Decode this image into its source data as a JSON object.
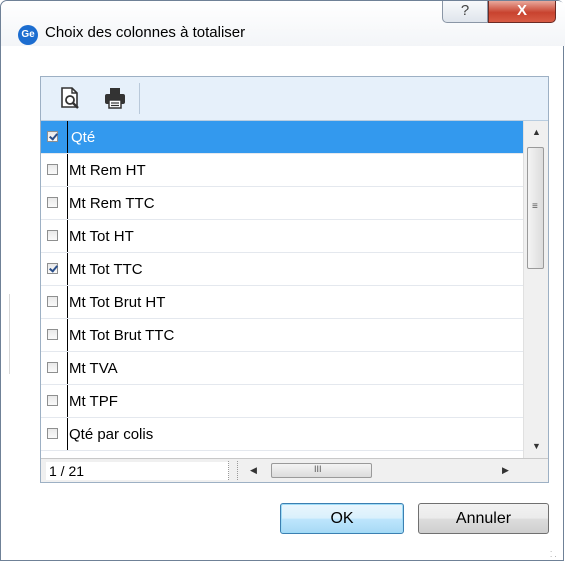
{
  "window": {
    "app_icon_text": "Ge",
    "title": "Choix des colonnes à totaliser",
    "help_symbol": "?",
    "close_symbol": "X"
  },
  "toolbar": {
    "buttons": [
      {
        "icon": "print-preview-icon"
      },
      {
        "icon": "printer-icon"
      }
    ]
  },
  "columns_list": {
    "rows": [
      {
        "label": "Qté",
        "checked": true,
        "selected": true
      },
      {
        "label": "Mt Rem HT",
        "checked": false,
        "selected": false
      },
      {
        "label": "Mt Rem TTC",
        "checked": false,
        "selected": false
      },
      {
        "label": "Mt Tot HT",
        "checked": false,
        "selected": false
      },
      {
        "label": "Mt Tot TTC",
        "checked": true,
        "selected": false
      },
      {
        "label": "Mt Tot Brut HT",
        "checked": false,
        "selected": false
      },
      {
        "label": "Mt Tot Brut TTC",
        "checked": false,
        "selected": false
      },
      {
        "label": "Mt TVA",
        "checked": false,
        "selected": false
      },
      {
        "label": "Mt TPF",
        "checked": false,
        "selected": false
      },
      {
        "label": "Qté par colis",
        "checked": false,
        "selected": false
      }
    ]
  },
  "scrollbars": {
    "up_arrow": "▲",
    "down_arrow": "▼",
    "left_arrow": "◀",
    "right_arrow": "▶",
    "v_grip": "≡",
    "h_grip": "III"
  },
  "status": {
    "counter": "1 / 21"
  },
  "buttons": {
    "ok": "OK",
    "cancel": "Annuler"
  }
}
